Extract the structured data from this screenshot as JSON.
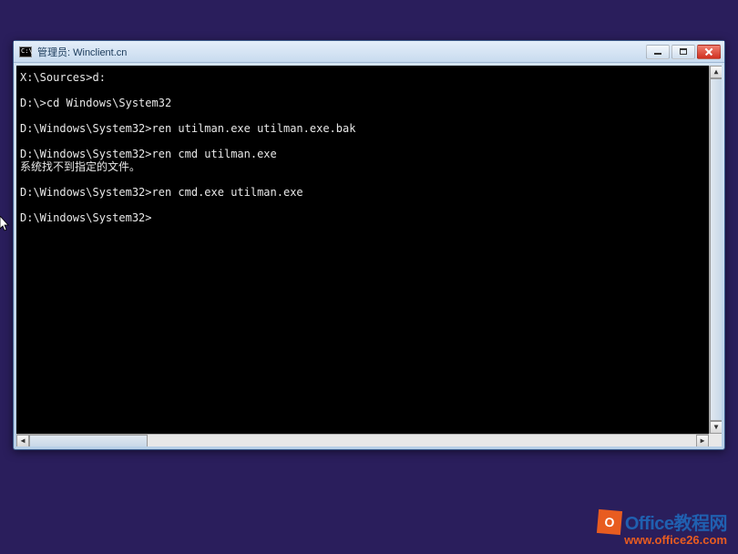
{
  "window": {
    "title": "管理员:  Winclient.cn",
    "icon_label": "C:\\"
  },
  "terminal": {
    "lines": [
      "X:\\Sources>d:",
      "",
      "D:\\>cd Windows\\System32",
      "",
      "D:\\Windows\\System32>ren utilman.exe utilman.exe.bak",
      "",
      "D:\\Windows\\System32>ren cmd utilman.exe",
      "系统找不到指定的文件。",
      "",
      "D:\\Windows\\System32>ren cmd.exe utilman.exe",
      "",
      "D:\\Windows\\System32>"
    ]
  },
  "watermark": {
    "brand": "Office",
    "brand_cn": "教程网",
    "url": "www.office26.com",
    "icon_letter": "O"
  }
}
